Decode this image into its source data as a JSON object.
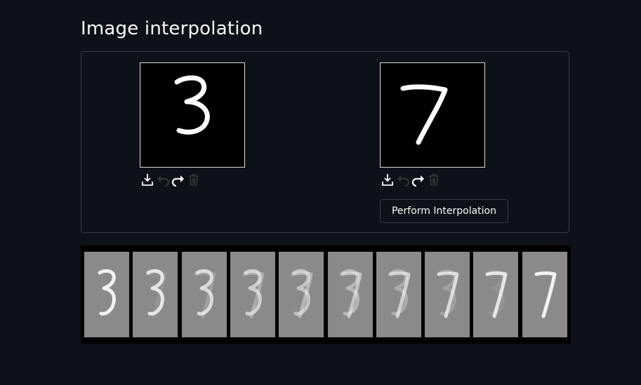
{
  "page": {
    "title": "Image interpolation"
  },
  "canvas_left": {
    "digit": "3",
    "tools": [
      "download-icon",
      "undo-icon",
      "redo-icon",
      "trash-icon"
    ]
  },
  "canvas_right": {
    "digit": "7",
    "tools": [
      "download-icon",
      "undo-icon",
      "redo-icon",
      "trash-icon"
    ]
  },
  "actions": {
    "interpolate_label": "Perform Interpolation"
  },
  "result": {
    "frame_count": 10,
    "start_digit": "3",
    "end_digit": "7"
  }
}
